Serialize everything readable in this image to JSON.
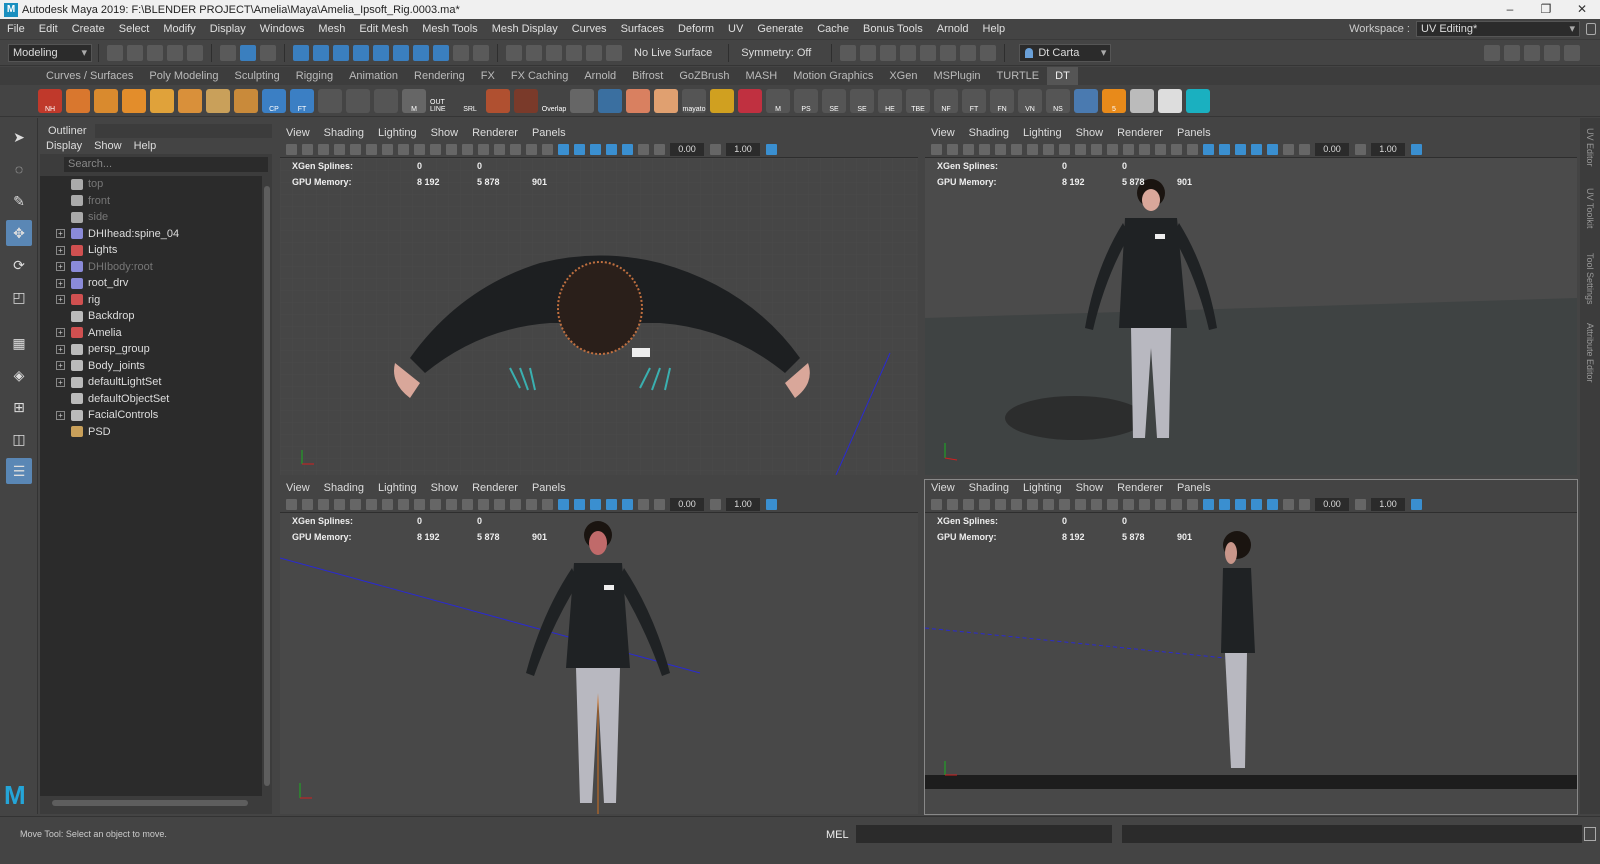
{
  "window": {
    "title": "Autodesk Maya 2019: F:\\BLENDER PROJECT\\Amelia\\Maya\\Amelia_Ipsoft_Rig.0003.ma*"
  },
  "menu": [
    "File",
    "Edit",
    "Create",
    "Select",
    "Modify",
    "Display",
    "Windows",
    "Mesh",
    "Edit Mesh",
    "Mesh Tools",
    "Mesh Display",
    "Curves",
    "Surfaces",
    "Deform",
    "UV",
    "Generate",
    "Cache",
    "Bonus Tools",
    "Arnold",
    "Help"
  ],
  "workspace": {
    "label": "Workspace :",
    "value": "UV Editing*"
  },
  "statusline": {
    "mode": "Modeling",
    "live_surface": "No Live Surface",
    "symmetry": "Symmetry: Off",
    "camera": "Dt Carta"
  },
  "shelf_tabs": [
    "Curves / Surfaces",
    "Poly Modeling",
    "Sculpting",
    "Rigging",
    "Animation",
    "Rendering",
    "FX",
    "FX Caching",
    "Arnold",
    "Bifrost",
    "GoZBrush",
    "MASH",
    "Motion Graphics",
    "XGen",
    "MSPlugin",
    "TURTLE",
    "DT"
  ],
  "shelf_active": "DT",
  "shelf_icons": [
    {
      "label": "NH",
      "color": "#c0392b"
    },
    {
      "label": "",
      "color": "#d9772e"
    },
    {
      "label": "",
      "color": "#d98a2e"
    },
    {
      "label": "",
      "color": "#e38d2b"
    },
    {
      "label": "",
      "color": "#e0a23a"
    },
    {
      "label": "",
      "color": "#d9903a"
    },
    {
      "label": "",
      "color": "#c9a05a"
    },
    {
      "label": "",
      "color": "#c98a3a"
    },
    {
      "label": "CP",
      "color": "#3b7fc4"
    },
    {
      "label": "FT",
      "color": "#3b7fc4"
    },
    {
      "label": "",
      "color": "#555"
    },
    {
      "label": "",
      "color": "#555"
    },
    {
      "label": "",
      "color": "#555"
    },
    {
      "label": "M",
      "color": "#666"
    },
    {
      "label": "OUT LINE",
      "color": "#444"
    },
    {
      "label": "SRL",
      "color": "#444"
    },
    {
      "label": "",
      "color": "#b05030"
    },
    {
      "label": "",
      "color": "#7a3a2a"
    },
    {
      "label": "Overlap",
      "color": "#444"
    },
    {
      "label": "",
      "color": "#666"
    },
    {
      "label": "",
      "color": "#3a6fa0"
    },
    {
      "label": "",
      "color": "#d98060"
    },
    {
      "label": "",
      "color": "#e0a070"
    },
    {
      "label": "mayato",
      "color": "#555"
    },
    {
      "label": "",
      "color": "#d0a020"
    },
    {
      "label": "",
      "color": "#c03040"
    },
    {
      "label": "M",
      "color": "#555"
    },
    {
      "label": "PS",
      "color": "#555"
    },
    {
      "label": "SE",
      "color": "#555"
    },
    {
      "label": "SE",
      "color": "#555"
    },
    {
      "label": "HE",
      "color": "#555"
    },
    {
      "label": "TBE",
      "color": "#555"
    },
    {
      "label": "NF",
      "color": "#555"
    },
    {
      "label": "FT",
      "color": "#555"
    },
    {
      "label": "FN",
      "color": "#555"
    },
    {
      "label": "VN",
      "color": "#555"
    },
    {
      "label": "NS",
      "color": "#555"
    },
    {
      "label": "",
      "color": "#4a7ab0"
    },
    {
      "label": "5",
      "color": "#e88a1a"
    },
    {
      "label": "",
      "color": "#bbb"
    },
    {
      "label": "",
      "color": "#ddd"
    },
    {
      "label": "",
      "color": "#1ab0c0"
    }
  ],
  "outliner": {
    "tab": "Outliner",
    "menu": [
      "Display",
      "Show",
      "Help"
    ],
    "search_placeholder": "Search...",
    "items": [
      {
        "label": "top",
        "dim": true,
        "expand": false,
        "color": "#aaa"
      },
      {
        "label": "front",
        "dim": true,
        "expand": false,
        "color": "#aaa"
      },
      {
        "label": "side",
        "dim": true,
        "expand": false,
        "color": "#aaa"
      },
      {
        "label": "DHIhead:spine_04",
        "dim": false,
        "expand": true,
        "color": "#8a8ad8"
      },
      {
        "label": "Lights",
        "dim": false,
        "expand": true,
        "color": "#d05050"
      },
      {
        "label": "DHIbody:root",
        "dim": true,
        "expand": true,
        "color": "#8a8ad8"
      },
      {
        "label": "root_drv",
        "dim": false,
        "expand": true,
        "color": "#8a8ad8"
      },
      {
        "label": "rig",
        "dim": false,
        "expand": true,
        "color": "#d05050"
      },
      {
        "label": "Backdrop",
        "dim": false,
        "expand": false,
        "color": "#bbb"
      },
      {
        "label": "Amelia",
        "dim": false,
        "expand": true,
        "color": "#d05050"
      },
      {
        "label": "persp_group",
        "dim": false,
        "expand": true,
        "color": "#bbb"
      },
      {
        "label": "Body_joints",
        "dim": false,
        "expand": true,
        "color": "#bbb"
      },
      {
        "label": "defaultLightSet",
        "dim": false,
        "expand": true,
        "color": "#bbb"
      },
      {
        "label": "defaultObjectSet",
        "dim": false,
        "expand": false,
        "color": "#bbb"
      },
      {
        "label": "FacialControls",
        "dim": false,
        "expand": true,
        "color": "#bbb"
      },
      {
        "label": "PSD",
        "dim": false,
        "expand": false,
        "color": "#c9a05a"
      }
    ]
  },
  "viewport_menu": [
    "View",
    "Shading",
    "Lighting",
    "Show",
    "Renderer",
    "Panels"
  ],
  "viewport_fields": {
    "val1": "0.00",
    "val2": "1.00"
  },
  "hud": {
    "xgen_label": "XGen Splines:",
    "xgen_v1": "0",
    "xgen_v2": "0",
    "gpu_label": "GPU Memory:",
    "gpu_v1": "8 192",
    "gpu_v2": "5 878",
    "gpu_v3": "901"
  },
  "right_panel_tabs": [
    "UV Editor",
    "UV Toolkit",
    "Tool Settings",
    "Attribute Editor"
  ],
  "help_line": "Move Tool: Select an object to move.",
  "cmd_label": "MEL"
}
